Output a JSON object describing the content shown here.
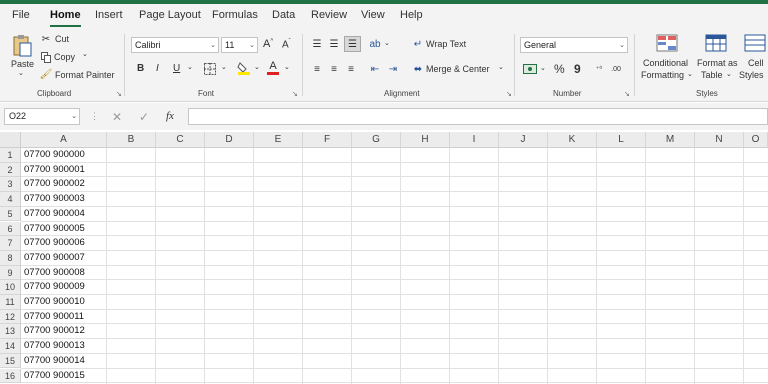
{
  "menu": {
    "tabs": [
      "File",
      "Home",
      "Insert",
      "Page Layout",
      "Formulas",
      "Data",
      "Review",
      "View",
      "Help"
    ],
    "active": "Home"
  },
  "ribbon": {
    "clipboard": {
      "paste": "Paste",
      "cut": "Cut",
      "copy": "Copy",
      "format_painter": "Format Painter",
      "label": "Clipboard"
    },
    "font": {
      "name": "Calibri",
      "size": "11",
      "bold": "B",
      "italic": "I",
      "underline": "U",
      "label": "Font"
    },
    "alignment": {
      "wrap_text": "Wrap Text",
      "merge_center": "Merge & Center",
      "label": "Alignment"
    },
    "number": {
      "format": "General",
      "percent": "%",
      "comma": "9",
      "label": "Number"
    },
    "styles": {
      "conditional": "Conditional",
      "formatting": "Formatting",
      "format_as": "Format as",
      "table": "Table",
      "cell": "Cell",
      "cell_styles": "Styles",
      "label": "Styles"
    }
  },
  "formula_bar": {
    "name_box": "O22",
    "fx": "fx",
    "value": ""
  },
  "columns": [
    "A",
    "B",
    "C",
    "D",
    "E",
    "F",
    "G",
    "H",
    "I",
    "J",
    "K",
    "L",
    "M",
    "N",
    "O"
  ],
  "rows": [
    {
      "n": "1",
      "a": "07700 900000"
    },
    {
      "n": "2",
      "a": "07700 900001"
    },
    {
      "n": "3",
      "a": "07700 900002"
    },
    {
      "n": "4",
      "a": "07700 900003"
    },
    {
      "n": "5",
      "a": "07700 900004"
    },
    {
      "n": "6",
      "a": "07700 900005"
    },
    {
      "n": "7",
      "a": "07700 900006"
    },
    {
      "n": "8",
      "a": "07700 900007"
    },
    {
      "n": "9",
      "a": "07700 900008"
    },
    {
      "n": "10",
      "a": "07700 900009"
    },
    {
      "n": "11",
      "a": "07700 900010"
    },
    {
      "n": "12",
      "a": "07700 900011"
    },
    {
      "n": "13",
      "a": "07700 900012"
    },
    {
      "n": "14",
      "a": "07700 900013"
    },
    {
      "n": "15",
      "a": "07700 900014"
    },
    {
      "n": "16",
      "a": "07700 900015"
    }
  ],
  "colors": {
    "accent": "#217346",
    "font_color_bar": "#e02020",
    "highlight_bar": "#ffe600"
  }
}
